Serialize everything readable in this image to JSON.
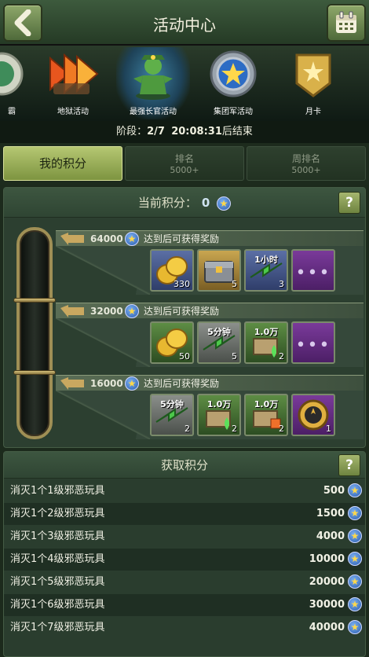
{
  "header": {
    "title": "活动中心"
  },
  "activities": [
    {
      "label": "霸",
      "icon": "medal-icon"
    },
    {
      "label": "地狱活动",
      "icon": "fire-arrow-icon"
    },
    {
      "label": "最强长官活动",
      "icon": "green-soldier-icon"
    },
    {
      "label": "集团军活动",
      "icon": "star-badge-icon"
    },
    {
      "label": "月卡",
      "icon": "golden-emblem-icon"
    }
  ],
  "phase": {
    "prefix": "阶段：",
    "stage": "2/7",
    "time": "20:08:31",
    "suffix": "后结束"
  },
  "tabs": [
    {
      "label": "我的积分"
    },
    {
      "label": "排名",
      "sub": "5000+"
    },
    {
      "label": "周排名",
      "sub": "5000+"
    }
  ],
  "score_panel": {
    "label": "当前积分：",
    "value": "0",
    "help": "?"
  },
  "milestones": [
    {
      "points": "64000",
      "desc": "达到后可获得奖励",
      "items": [
        {
          "kind": "gold-coins",
          "count": "330"
        },
        {
          "kind": "supply-chest",
          "count": "5"
        },
        {
          "kind": "speedup",
          "text": "1小时",
          "count": "3"
        },
        {
          "kind": "more",
          "count": ""
        }
      ]
    },
    {
      "points": "32000",
      "desc": "达到后可获得奖励",
      "items": [
        {
          "kind": "gold-coins",
          "count": "50"
        },
        {
          "kind": "speedup",
          "text": "5分钟",
          "count": "5"
        },
        {
          "kind": "resource-green",
          "text": "1.0万",
          "count": "2"
        },
        {
          "kind": "more",
          "count": ""
        }
      ]
    },
    {
      "points": "16000",
      "desc": "达到后可获得奖励",
      "items": [
        {
          "kind": "speedup",
          "text": "5分钟",
          "count": "2"
        },
        {
          "kind": "resource-green",
          "text": "1.0万",
          "count": "2"
        },
        {
          "kind": "resource-orange",
          "text": "1.0万",
          "count": "2"
        },
        {
          "kind": "medal",
          "count": "1"
        }
      ]
    }
  ],
  "earn": {
    "title": "获取积分",
    "help": "?",
    "rows": [
      {
        "label": "消灭1个1级邪恶玩具",
        "points": "500"
      },
      {
        "label": "消灭1个2级邪恶玩具",
        "points": "1500"
      },
      {
        "label": "消灭1个3级邪恶玩具",
        "points": "4000"
      },
      {
        "label": "消灭1个4级邪恶玩具",
        "points": "10000"
      },
      {
        "label": "消灭1个5级邪恶玩具",
        "points": "20000"
      },
      {
        "label": "消灭1个6级邪恶玩具",
        "points": "30000"
      },
      {
        "label": "消灭1个7级邪恶玩具",
        "points": "40000"
      }
    ]
  }
}
